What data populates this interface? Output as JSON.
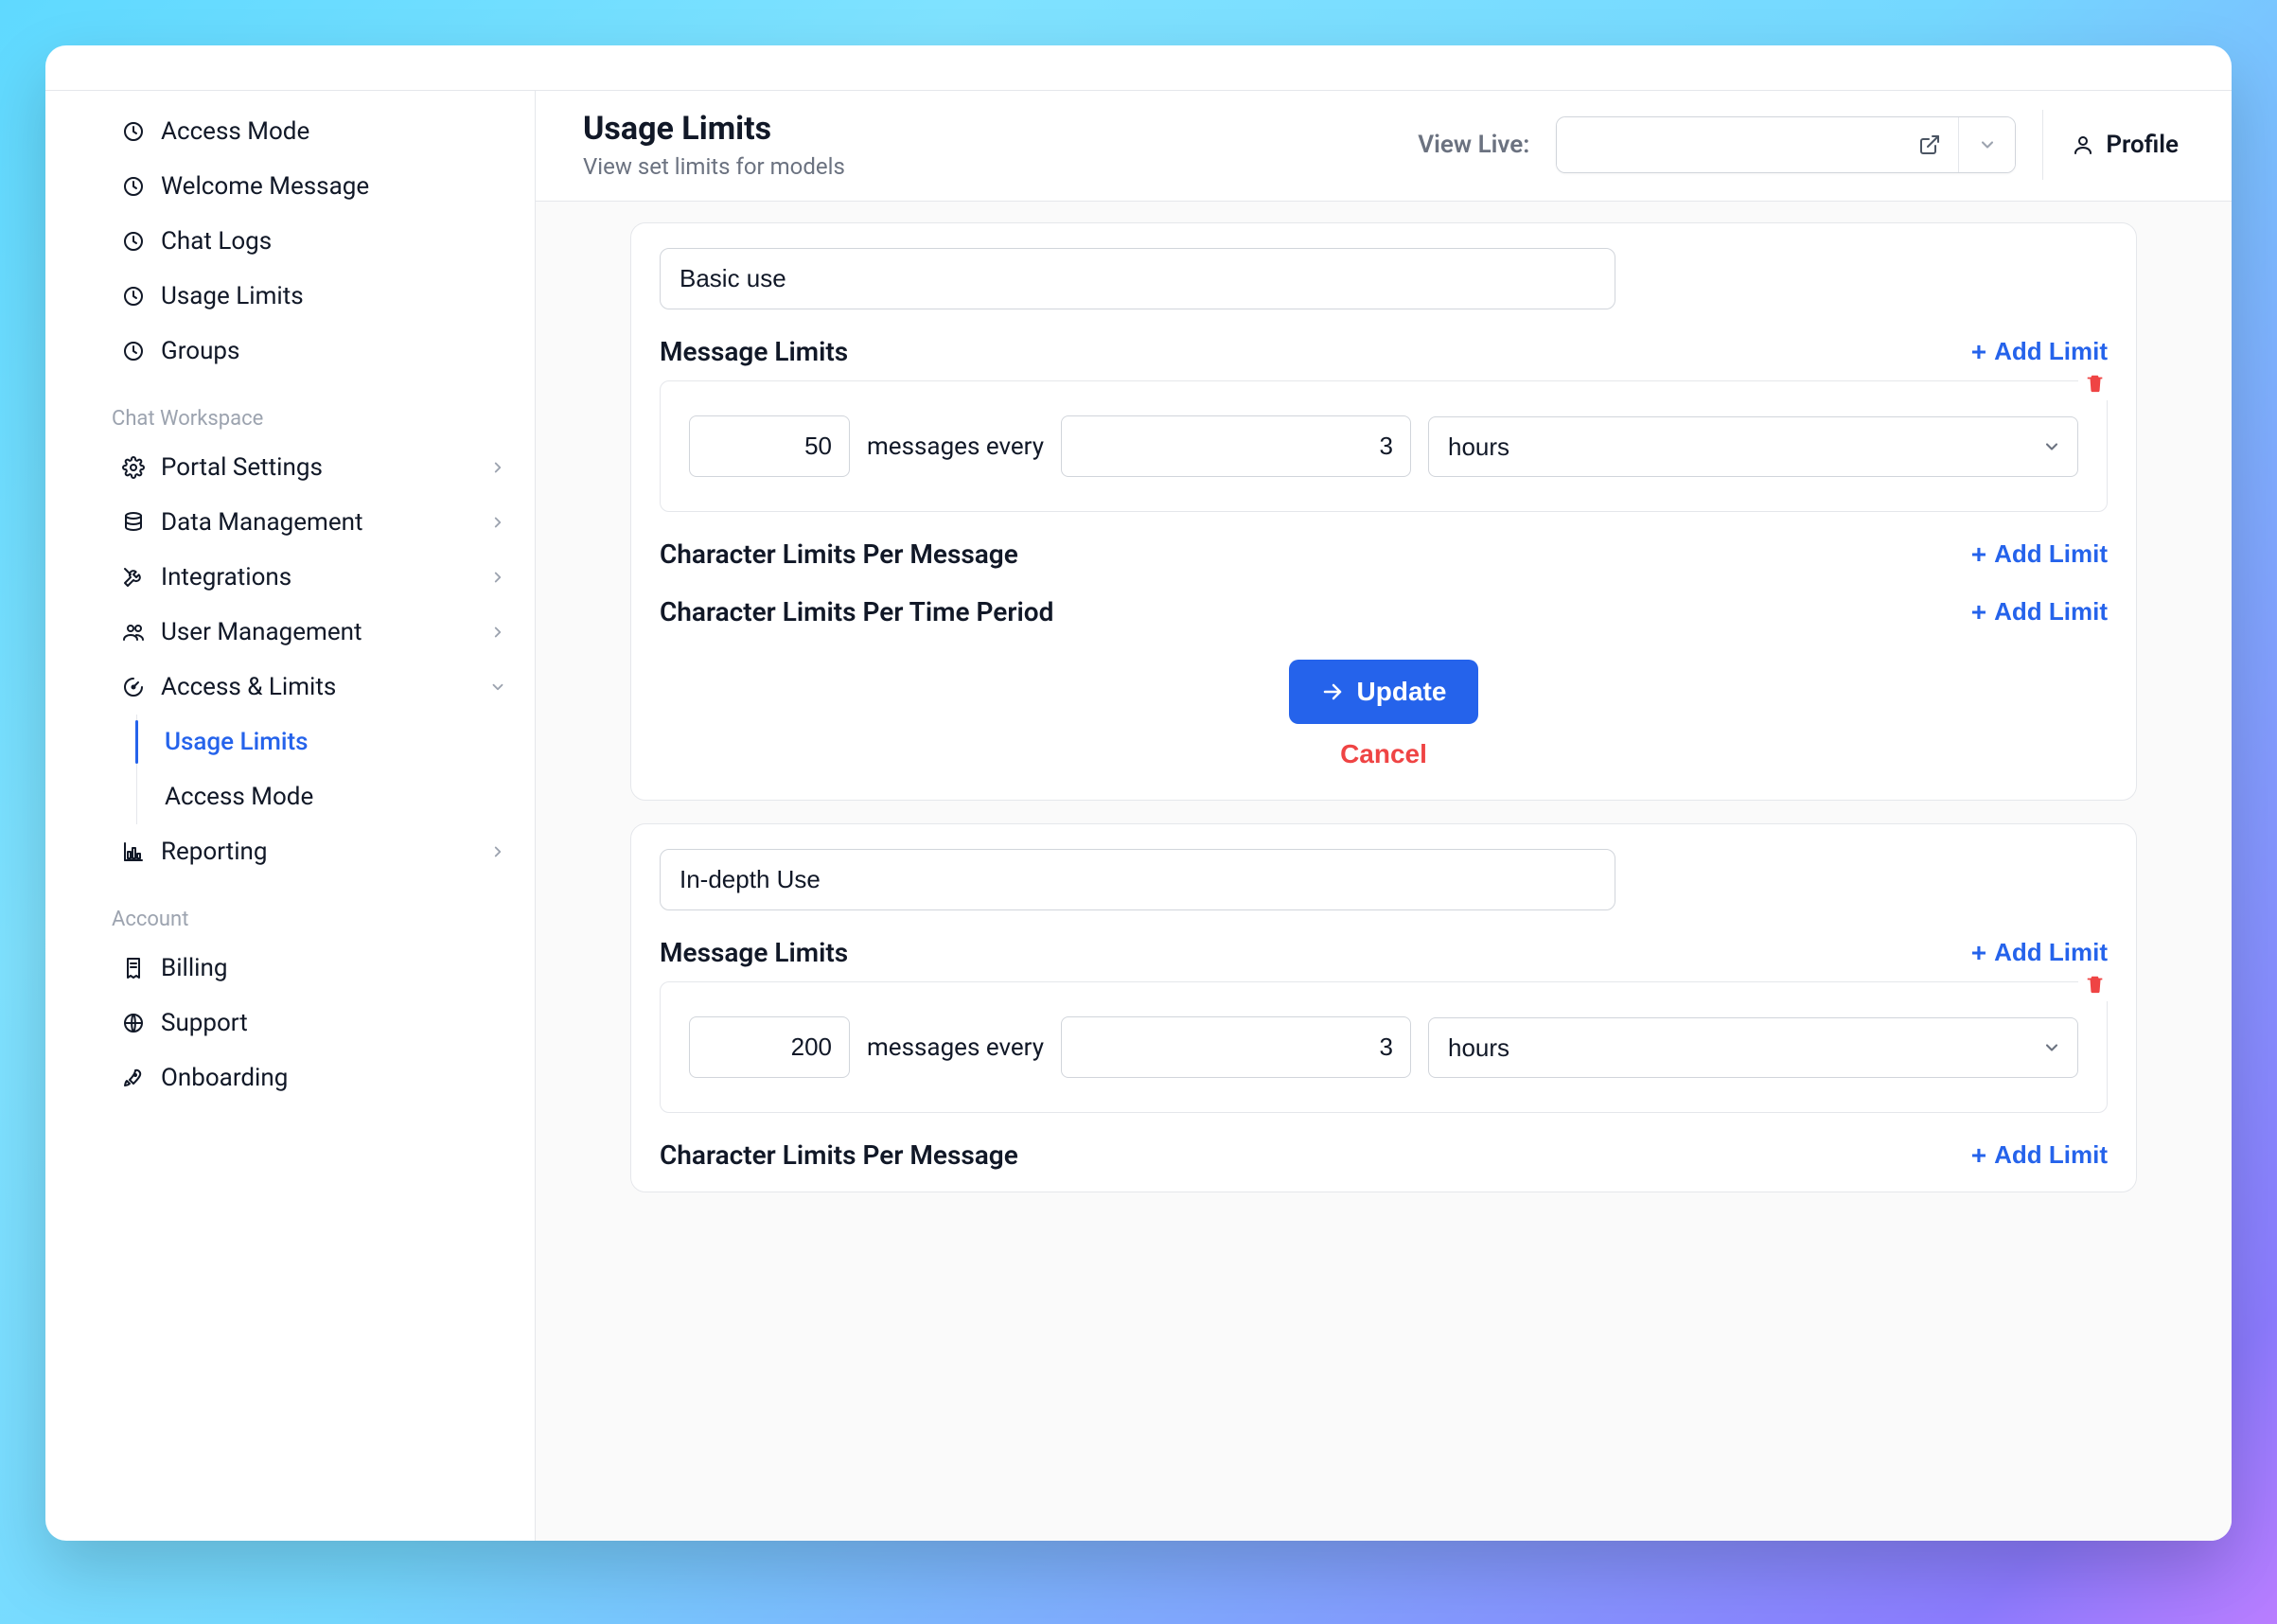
{
  "sidebar": {
    "items_top": [
      {
        "label": "Access Mode",
        "icon": "clock-icon",
        "key": "access-mode"
      },
      {
        "label": "Welcome Message",
        "icon": "clock-icon",
        "key": "welcome-message"
      },
      {
        "label": "Chat Logs",
        "icon": "clock-icon",
        "key": "chat-logs"
      },
      {
        "label": "Usage Limits",
        "icon": "clock-icon",
        "key": "usage-limits-sidebar-top"
      },
      {
        "label": "Groups",
        "icon": "clock-icon",
        "key": "groups"
      }
    ],
    "group_workspace_title": "Chat Workspace",
    "workspace_items": [
      {
        "label": "Portal Settings",
        "icon": "gear-icon",
        "key": "portal-settings",
        "chevron": "right"
      },
      {
        "label": "Data Management",
        "icon": "database-icon",
        "key": "data-management",
        "chevron": "right"
      },
      {
        "label": "Integrations",
        "icon": "tools-icon",
        "key": "integrations",
        "chevron": "right"
      },
      {
        "label": "User Management",
        "icon": "users-icon",
        "key": "user-management",
        "chevron": "right"
      },
      {
        "label": "Access & Limits",
        "icon": "gauge-icon",
        "key": "access-limits",
        "chevron": "down"
      }
    ],
    "access_limits_children": [
      {
        "label": "Usage Limits",
        "key": "usage-limits",
        "active": true
      },
      {
        "label": "Access Mode",
        "key": "access-mode-sub",
        "active": false
      }
    ],
    "reporting": {
      "label": "Reporting",
      "icon": "bar-chart-icon",
      "key": "reporting",
      "chevron": "right"
    },
    "group_account_title": "Account",
    "account_items": [
      {
        "label": "Billing",
        "icon": "receipt-icon",
        "key": "billing"
      },
      {
        "label": "Support",
        "icon": "globe-icon",
        "key": "support"
      },
      {
        "label": "Onboarding",
        "icon": "rocket-icon",
        "key": "onboarding"
      }
    ]
  },
  "header": {
    "title": "Usage Limits",
    "subtitle": "View set limits for models",
    "view_live_label": "View Live:",
    "view_live_value": "",
    "profile_label": "Profile"
  },
  "content": {
    "add_limit_label": "Add Limit",
    "messages_every_label": "messages every",
    "unit_options": [
      "hours"
    ],
    "update_label": "Update",
    "cancel_label": "Cancel",
    "sections": {
      "message_limits": "Message Limits",
      "char_per_message": "Character Limits Per Message",
      "char_per_time": "Character Limits Per Time Period"
    },
    "cards": [
      {
        "name": "Basic use",
        "message_limits": [
          {
            "count": "50",
            "every": "3",
            "unit": "hours"
          }
        ],
        "show_actions": true
      },
      {
        "name": "In-depth Use",
        "message_limits": [
          {
            "count": "200",
            "every": "3",
            "unit": "hours"
          }
        ],
        "show_actions": false
      }
    ]
  }
}
